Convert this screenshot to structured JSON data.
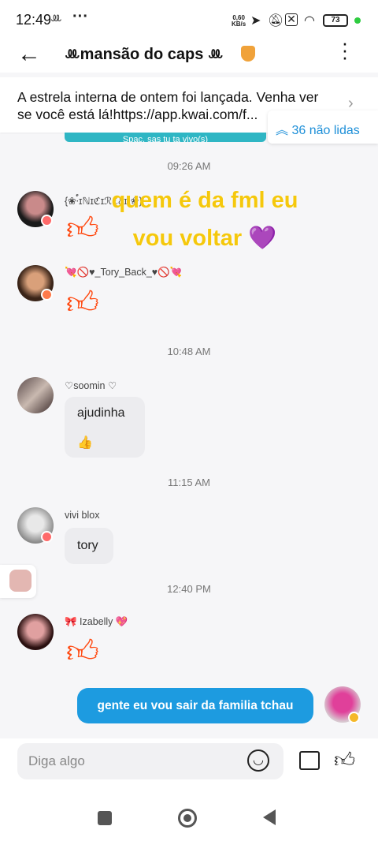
{
  "status_bar": {
    "time": "12:49",
    "app_icons": "ꔛ",
    "more": "···",
    "net_speed": "0,60",
    "net_unit": "KB/s",
    "battery": "73",
    "icons": [
      "location-icon",
      "mute-icon",
      "sim-icon",
      "wifi-icon",
      "battery-icon"
    ]
  },
  "header": {
    "title": "ꔛmansão do caps ꔛ",
    "back_icon": "arrow-left-icon",
    "more_icon": "kebab-icon"
  },
  "notice": {
    "text": "A estrela interna de ontem foi lançada. Venha ver se você está lá!https://app.kwai.com/f...",
    "unread": "36 não lidas",
    "peek_text": "Spac, sas tu ta vivo(s)"
  },
  "overlay": {
    "line1": "quem é da fml eu",
    "line2": "vou voltar 💜"
  },
  "messages": {
    "ts1": "09:26 AM",
    "m1_name": "{❀·ࠬ࠭ɪℕɪℭɪℛℰℰɪ·❀}",
    "m2_name": "💘🚫♥_Tory_Back_♥🚫💘",
    "ts2": "10:48 AM",
    "m3_name": "♡soomin ♡",
    "m3_text": "ajudinha",
    "m3_emoji": "👍",
    "ts3": "11:15 AM",
    "m4_name": "vivi blox",
    "m4_text": "tory",
    "ts4": "12:40 PM",
    "m5_name": "🎀 Izabelly 💖",
    "mine_text": "gente eu vou sair da familia tchau"
  },
  "colors": {
    "accent": "#1d9be0",
    "thumb": "#ff4a12",
    "overlay_text": "#f5c80c"
  },
  "input": {
    "placeholder": "Diga algo"
  }
}
